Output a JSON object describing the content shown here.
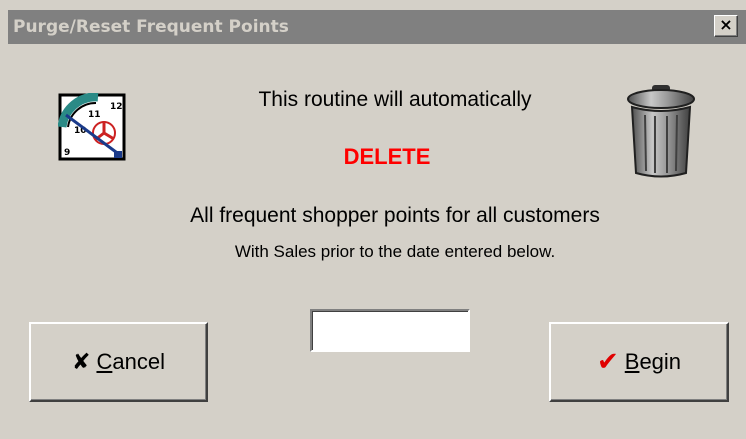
{
  "window": {
    "title": "Purge/Reset Frequent Points",
    "close_glyph": "×"
  },
  "message": {
    "line1": "This routine will automatically",
    "emphasis": "DELETE",
    "line2": "All frequent shopper points for all customers",
    "line3": "With Sales prior to the date entered below."
  },
  "icons": {
    "left": "clock-icon",
    "right": "trash-can-icon"
  },
  "date_input": {
    "value": "",
    "placeholder": ""
  },
  "buttons": {
    "cancel": {
      "icon": "x-icon",
      "glyph": "✘",
      "mnemonic": "C",
      "rest": "ancel"
    },
    "begin": {
      "icon": "checkmark-icon",
      "glyph": "✔",
      "mnemonic": "B",
      "rest": "egin"
    }
  },
  "colors": {
    "dialog_bg": "#d4d0c8",
    "titlebar_bg": "#808080",
    "delete_text": "#ff0000",
    "check_color": "#e00000"
  }
}
